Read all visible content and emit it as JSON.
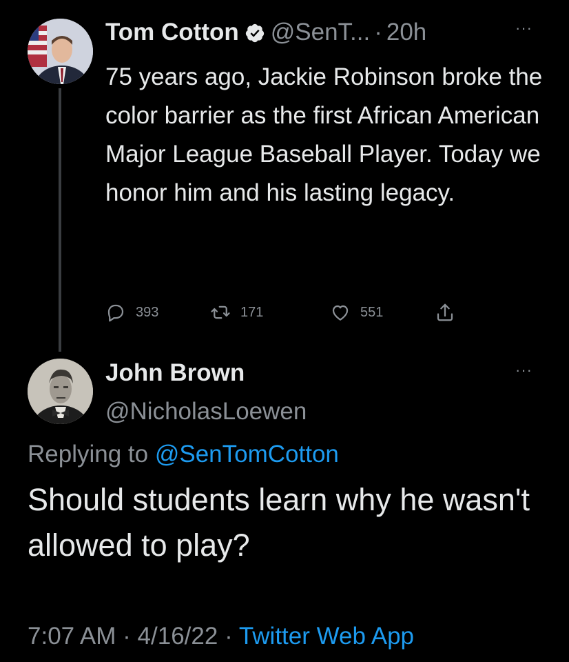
{
  "tweet": {
    "author_name": "Tom Cotton",
    "author_handle": "@SenT...",
    "separator": "·",
    "time_ago": "20h",
    "more": "···",
    "text": "75 years ago, Jackie Robinson broke the color barrier as the first African American Major League Baseball Player. Today we honor him and his lasting legacy.",
    "stats": {
      "replies": "393",
      "retweets": "171",
      "likes": "551"
    },
    "verified_icon": "verified-badge-icon"
  },
  "reply": {
    "author_name": "John Brown",
    "author_handle": "@NicholasLoewen",
    "more": "···",
    "replying_prefix": "Replying to",
    "replying_mention": "@SenTomCotton",
    "text": "Should students learn why he wasn't allowed to play?",
    "timestamp": "7:07 AM",
    "date": "4/16/22",
    "separator": "·",
    "source": "Twitter Web App"
  },
  "colors": {
    "background": "#000000",
    "text_primary": "#e7e9ea",
    "text_secondary": "#8b9096",
    "link": "#1d9bf0"
  }
}
